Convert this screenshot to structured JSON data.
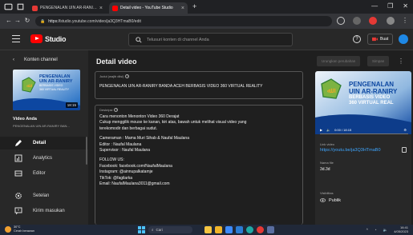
{
  "browser": {
    "tabs": [
      {
        "title": "PENGENALAN UIN AR-RANIRY",
        "active": false,
        "fav_color": "#e53935"
      },
      {
        "title": "Detail video - YouTube Studio",
        "active": true,
        "fav_color": "#ff0000"
      }
    ],
    "new_tab": "+",
    "url_prefix": "https://",
    "url": "studio.youtube.com/video/ja3Q3HTmaB0/edit",
    "window_controls": [
      "—",
      "❐",
      "✕"
    ]
  },
  "header": {
    "logo_text": "Studio",
    "search_placeholder": "Telusuri konten di channel Anda",
    "create_label": "Buat"
  },
  "sidebar": {
    "back_label": "Konten channel",
    "thumbnail_title": [
      "PENGENALAN",
      "UIN AR-RANIRY",
      "BERBASIS VIDEO",
      "360 VIRTUAL REALITY"
    ],
    "duration": "18:15",
    "video_label": "Video Anda",
    "video_subtitle": "PENGENALAN UIN AR-RANIRY BAN...",
    "items": [
      {
        "label": "Detail",
        "icon": "pencil-icon",
        "active": true
      },
      {
        "label": "Analytics",
        "icon": "analytics-icon",
        "active": false
      },
      {
        "label": "Editor",
        "icon": "editor-icon",
        "active": false
      },
      {
        "label": "Setelan",
        "icon": "gear-icon",
        "active": false
      },
      {
        "label": "Kirim masukan",
        "icon": "feedback-icon",
        "active": false
      }
    ]
  },
  "main": {
    "page_title": "Detail video",
    "undo_label": "Urungkan perubahan",
    "save_label": "Simpan",
    "title_field": {
      "label": "Judul (wajib diisi)",
      "value": "PENGENALAN UIN AR-RANIRY BANDA ACEH BERBASIS VIDEO 360 VIRTUAL REALITY"
    },
    "desc_field": {
      "label": "Deskripsi",
      "lines": [
        "Cara menonton Menonton Video 360 Derajat",
        "Cukup menggilik mouse ke kanan, kiri atas, bawah untuk melihat visual video yang",
        "terekomodir dan berbagai sudut.",
        "",
        "Cameraman : Mama Muri Sihab & Naufal Maulana",
        "Editor : Naufal Maulana",
        "Supervisor : Naufal Maulana",
        "",
        "FOLLOW US:",
        "Facebook: facebook.com/NaufalMaulana",
        "Instagram: @ainnupalkatamje",
        "TikTok: @fagilarka",
        "Email: NaufalMaulana3011@gmail.com"
      ]
    }
  },
  "preview": {
    "title_lines": [
      "PENGENALAN",
      "UIN AR-RANIRY",
      "BERBASIS VIDEO",
      "360 VIRTUAL REAL"
    ],
    "time": "0:00 / 18:15",
    "link_label": "Link video",
    "link_value": "https://youtu.be/ja3Q3HTmaB0",
    "file_label": "Nama file",
    "file_value": "3d.3d",
    "visibility_label": "Visibilitas",
    "visibility_value": "Publik"
  },
  "taskbar": {
    "weather_temp": "30°C",
    "weather_desc": "Cerah berawan",
    "search_label": "Cari",
    "time": "16:41",
    "date": "4/05/2023",
    "apps": [
      {
        "icon": "files-icon",
        "color": "#f5c542"
      },
      {
        "icon": "explorer-icon",
        "color": "#f0b429"
      },
      {
        "icon": "store-icon",
        "color": "#3d8bfd"
      },
      {
        "icon": "word-icon",
        "color": "#2b7cd3"
      },
      {
        "icon": "edge-icon",
        "color": "#1fa9a5"
      },
      {
        "icon": "chrome-icon",
        "color": "#e53935"
      },
      {
        "icon": "settings-icon",
        "color": "#5a6ea0"
      }
    ]
  },
  "colors": {
    "accent_link": "#3ea6ff",
    "brand_red": "#ff0000",
    "thumb_blue": "#1565c0",
    "thumb_green": "#7cb342"
  }
}
